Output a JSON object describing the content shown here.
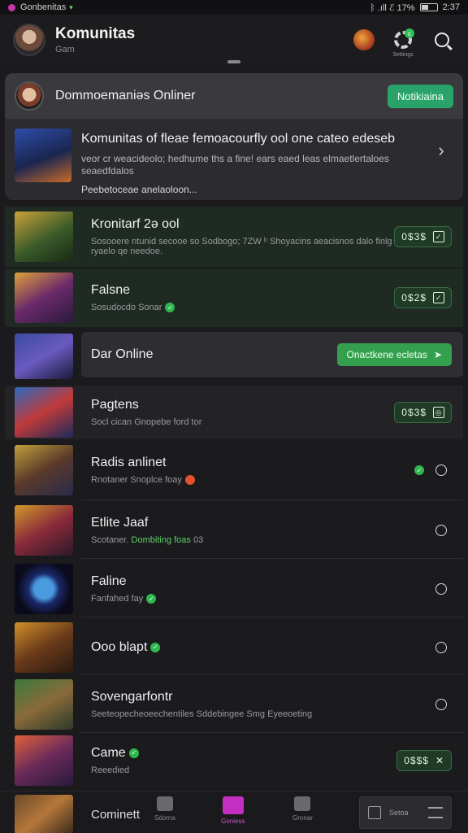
{
  "status": {
    "notification": "Gonbenitas",
    "small": "▾",
    "right": "ᛒ .ıll ℰ 17%",
    "time": "2:37"
  },
  "app_bar": {
    "title": "Komunitas",
    "subtitle": "Gam",
    "gear_badge": "c",
    "gear_label": "Settings"
  },
  "feature": {
    "header_title": "Dommoemaniəs Onliner",
    "notify_label": "Notikiaina",
    "line1": "Komunitas of fleae femoacourfly ool one cateo edeseb",
    "line2": "veor cr weacideolo; hedhume ths a fine! ears eaed leas elmaetlertaloes seaedfdalos",
    "line3": "Peebetoceae anelaoloon..."
  },
  "rows": [
    {
      "title": "Kronitarf 2ə ool",
      "sub": "Sosooere ntunid secooe so Sodbogo; 7ZW ʰ Shoyacins aeacisnos dalo finlg ryaelo qe needoe.",
      "pill": "0$3$",
      "pill_icon": "✓"
    },
    {
      "title": "Falsne",
      "sub": "Sosudocdo Sonar",
      "pill": "0$2$",
      "pill_icon": "✓"
    },
    {
      "title": "Dar Online",
      "button": "Onactkene ecletas",
      "button_icon": "➤"
    },
    {
      "title": "Pagtens",
      "sub": "Socl cican Gnopebe ford tor",
      "pill": "0$3$",
      "pill_icon": "◎"
    },
    {
      "title": "Radis anlinet",
      "sub": "Rnotaner Snoplce foay"
    },
    {
      "title": "Etlite Jaaf",
      "sub_prefix": "Scotaner.",
      "sub_green": "Dombiting foas",
      "sub_suffix": "03"
    },
    {
      "title": "Faline",
      "sub": "Fanfahed fay"
    },
    {
      "title": "Ooo blapt"
    },
    {
      "title": "Sovengarfontr",
      "sub": "Seeteopecheoeechentiles Sddebingee Smg Eyeeoeting"
    },
    {
      "title": "Came",
      "sub": "Reeedied",
      "pill": "0$$$",
      "pill_icon": "✕"
    }
  ],
  "bottom_nav": {
    "left_label": "Cominett",
    "items": [
      "Sdorna",
      "Goniess",
      "Gronar"
    ],
    "right_label": "Setoa"
  }
}
